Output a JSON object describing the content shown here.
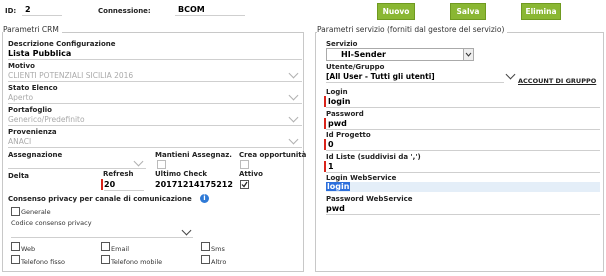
{
  "header": {
    "id_label": "ID:",
    "id_value": "2",
    "connessione_label": "Connessione:",
    "connessione_value": "BCOM",
    "buttons": {
      "nuovo": "Nuovo",
      "salva": "Salva",
      "elimina": "Elimina"
    }
  },
  "crm": {
    "title": "Parametri CRM",
    "descrizione_label": "Descrizione Configurazione",
    "descrizione_value": "Lista Pubblica",
    "motivo_label": "Motivo",
    "motivo_value": "CLIENTI POTENZIALI SICILIA 2016",
    "stato_label": "Stato Elenco",
    "stato_value": "Aperto",
    "portafoglio_label": "Portafoglio",
    "portafoglio_value": "Generico/Predefinito",
    "provenienza_label": "Provenienza",
    "provenienza_value": "ANACI",
    "assegnazione_label": "Assegnazione",
    "mantieni_label": "Mantieni Assegnaz.",
    "crea_label": "Crea opportunità",
    "delta_label": "Delta",
    "refresh_label": "Refresh",
    "refresh_value": "20",
    "ultimo_check_label": "Ultimo Check",
    "ultimo_check_value": "20171214175212",
    "attivo_label": "Attivo",
    "consenso_title": "Consenso privacy per canale di comunicazione",
    "generale_label": "Generale",
    "codice_label": "Codice consenso privacy",
    "channels": {
      "web": "Web",
      "email": "Email",
      "sms": "Sms",
      "telefono_fisso": "Telefono fisso",
      "telefono_mobile": "Telefono mobile",
      "altro": "Altro"
    }
  },
  "servizio": {
    "title": "Parametri servizio (forniti dal gestore del servizio)",
    "servizio_label": "Servizio",
    "servizio_value": "HI-Sender",
    "utente_label": "Utente/Gruppo",
    "utente_value": "[All User - Tutti gli utenti]",
    "account_link": "ACCOUNT DI GRUPPO",
    "login_label": "Login",
    "login_value": "login",
    "password_label": "Password",
    "password_value": "pwd",
    "id_progetto_label": "Id Progetto",
    "id_progetto_value": "0",
    "id_liste_label": "Id Liste (suddivisi da ',')",
    "id_liste_value": "1",
    "login_ws_label": "Login WebService",
    "login_ws_value": "login",
    "password_ws_label": "Password WebService",
    "password_ws_value": "pwd"
  },
  "colors": {
    "accent_green": "#8ab733",
    "required_red": "#d9241b",
    "info_blue": "#2f7ad6"
  }
}
